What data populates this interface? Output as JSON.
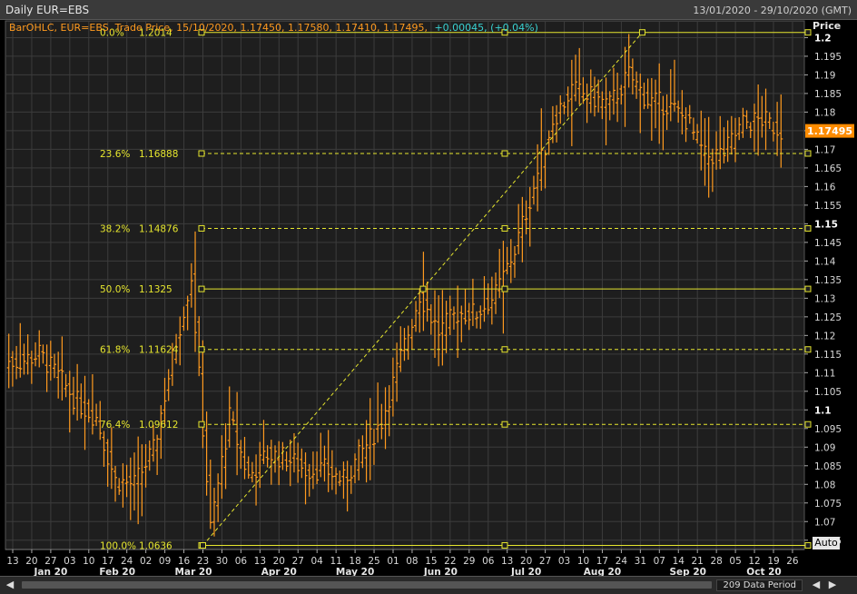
{
  "window": {
    "title": "Daily EUR=EBS",
    "date_range": "13/01/2020 - 29/10/2020 (GMT)"
  },
  "legend": {
    "series": "BarOHLC, EUR=EBS, Trade Price, 15/10/2020, 1.17450, 1.17580, 1.17410, 1.17495,",
    "change": "+0.00045, (+0.04%)"
  },
  "axis": {
    "price_title": "Price",
    "last_price_label": "1.17495",
    "auto_label": "Auto"
  },
  "footer": {
    "data_period": "209 Data Period"
  },
  "colors": {
    "bars": "#ff9a1f",
    "fib": "#e6e62e",
    "grid": "#3c3c3c",
    "last_price_bg": "#ff8c00"
  },
  "chart_data": {
    "type": "bar",
    "subtype": "ohlc",
    "instrument": "EUR=EBS",
    "ylim": [
      1.0625,
      1.2045
    ],
    "yticks": [
      1.065,
      1.07,
      1.075,
      1.08,
      1.085,
      1.09,
      1.095,
      1.1,
      1.105,
      1.11,
      1.115,
      1.12,
      1.125,
      1.13,
      1.135,
      1.14,
      1.145,
      1.15,
      1.155,
      1.16,
      1.165,
      1.17,
      1.175,
      1.18,
      1.185,
      1.19,
      1.195,
      1.2
    ],
    "bold_yticks": [
      1.1,
      1.15,
      1.2
    ],
    "xticks": [
      "13",
      "20",
      "27",
      "03",
      "10",
      "17",
      "24",
      "02",
      "09",
      "16",
      "23",
      "30",
      "06",
      "13",
      "20",
      "27",
      "04",
      "11",
      "18",
      "25",
      "01",
      "08",
      "15",
      "22",
      "29",
      "06",
      "13",
      "20",
      "27",
      "03",
      "10",
      "17",
      "24",
      "31",
      "07",
      "14",
      "21",
      "28",
      "05",
      "12",
      "19",
      "26"
    ],
    "month_labels": [
      {
        "label": "Jan 20",
        "index": 2
      },
      {
        "label": "Feb 20",
        "index": 5.5
      },
      {
        "label": "Mar 20",
        "index": 9.5
      },
      {
        "label": "Apr 20",
        "index": 14
      },
      {
        "label": "May 20",
        "index": 18
      },
      {
        "label": "Jun 20",
        "index": 22.5
      },
      {
        "label": "Jul 20",
        "index": 27
      },
      {
        "label": "Aug 20",
        "index": 31
      },
      {
        "label": "Sep 20",
        "index": 35.5
      },
      {
        "label": "Oct 20",
        "index": 39.5
      }
    ],
    "last_price": 1.17495,
    "weekly_closes": [
      1.113,
      1.115,
      1.109,
      1.102,
      1.098,
      1.081,
      1.08,
      1.089,
      1.114,
      1.136,
      1.068,
      1.098,
      1.082,
      1.088,
      1.087,
      1.084,
      1.084,
      1.081,
      1.089,
      1.097,
      1.114,
      1.131,
      1.121,
      1.126,
      1.126,
      1.131,
      1.143,
      1.16,
      1.178,
      1.186,
      1.184,
      1.182,
      1.19,
      1.183,
      1.182,
      1.178,
      1.168,
      1.169,
      1.177,
      1.178,
      1.175
    ],
    "fibonacci": [
      {
        "label": "0.0%",
        "value": "1.2014",
        "price": 1.2014,
        "style": "solid"
      },
      {
        "label": "23.6%",
        "value": "1.16888",
        "price": 1.16888,
        "style": "dashed"
      },
      {
        "label": "38.2%",
        "value": "1.14876",
        "price": 1.14876,
        "style": "dashed"
      },
      {
        "label": "50.0%",
        "value": "1.1325",
        "price": 1.1325,
        "style": "solid"
      },
      {
        "label": "61.8%",
        "value": "1.11624",
        "price": 1.11624,
        "style": "dashed"
      },
      {
        "label": "76.4%",
        "value": "1.09612",
        "price": 1.09612,
        "style": "dashed"
      },
      {
        "label": "100.0%",
        "value": "1.0636",
        "price": 1.0636,
        "style": "solid"
      }
    ],
    "trend_line": {
      "from": {
        "index": 10,
        "price": 1.0636
      },
      "to": {
        "index": 33.1,
        "price": 1.2014
      }
    }
  }
}
